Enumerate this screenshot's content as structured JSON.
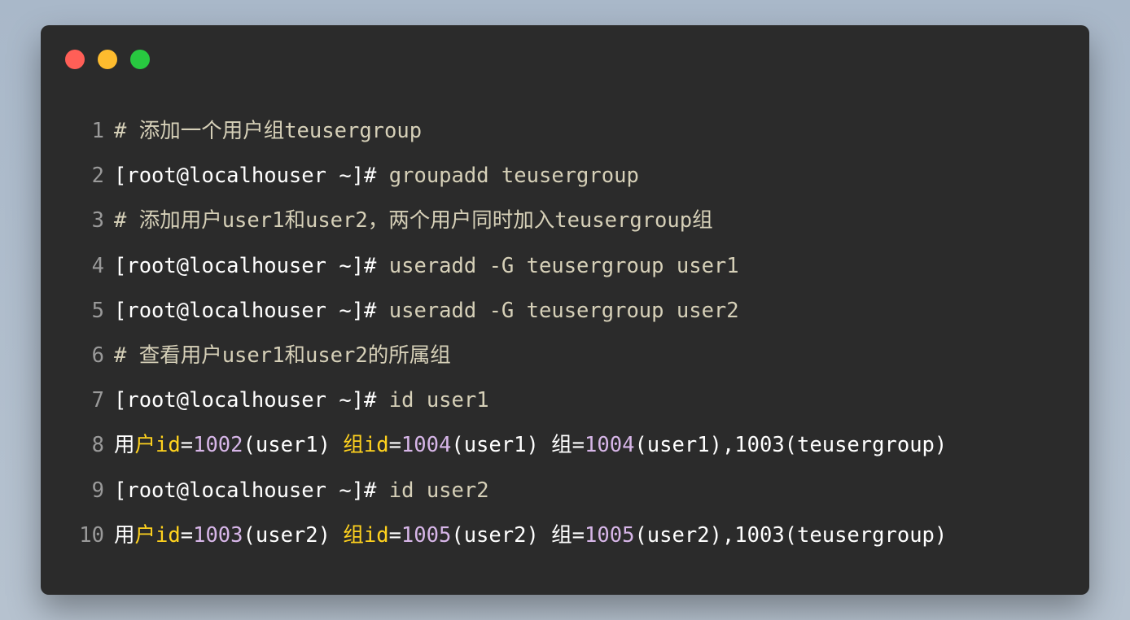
{
  "window": {
    "controls": {
      "close_color": "#ff5f57",
      "minimize_color": "#febc2e",
      "maximize_color": "#28c840"
    }
  },
  "code": {
    "lines": [
      {
        "number": "1",
        "tokens": [
          {
            "type": "comment",
            "text": "# 添加一个用户组teusergroup"
          }
        ]
      },
      {
        "number": "2",
        "tokens": [
          {
            "type": "prompt",
            "text": "[root@localhouser ~]#"
          },
          {
            "type": "cmd",
            "text": " groupadd teusergroup"
          }
        ]
      },
      {
        "number": "3",
        "tokens": [
          {
            "type": "comment",
            "text": "# 添加用户user1和user2，两个用户同时加入teusergroup组"
          }
        ]
      },
      {
        "number": "4",
        "tokens": [
          {
            "type": "prompt",
            "text": "[root@localhouser ~]#"
          },
          {
            "type": "cmd",
            "text": " useradd -G teusergroup user1"
          }
        ]
      },
      {
        "number": "5",
        "tokens": [
          {
            "type": "prompt",
            "text": "[root@localhouser ~]#"
          },
          {
            "type": "cmd",
            "text": " useradd -G teusergroup user2"
          }
        ]
      },
      {
        "number": "6",
        "tokens": [
          {
            "type": "comment",
            "text": "# 查看用户user1和user2的所属组"
          }
        ]
      },
      {
        "number": "7",
        "tokens": [
          {
            "type": "prompt",
            "text": "[root@localhouser ~]#"
          },
          {
            "type": "cmd",
            "text": " id user1"
          }
        ]
      },
      {
        "number": "8",
        "tokens": [
          {
            "type": "plain",
            "text": "用"
          },
          {
            "type": "keyword",
            "text": "户id"
          },
          {
            "type": "plain",
            "text": "="
          },
          {
            "type": "number",
            "text": "1002"
          },
          {
            "type": "plain",
            "text": "(user1) "
          },
          {
            "type": "keyword",
            "text": "组id"
          },
          {
            "type": "plain",
            "text": "="
          },
          {
            "type": "number",
            "text": "1004"
          },
          {
            "type": "plain",
            "text": "(user1) 组="
          },
          {
            "type": "number",
            "text": "1004"
          },
          {
            "type": "plain",
            "text": "(user1),1003(teusergroup)"
          }
        ]
      },
      {
        "number": "9",
        "tokens": [
          {
            "type": "prompt",
            "text": "[root@localhouser ~]#"
          },
          {
            "type": "cmd",
            "text": " id user2"
          }
        ]
      },
      {
        "number": "10",
        "tokens": [
          {
            "type": "plain",
            "text": "用"
          },
          {
            "type": "keyword",
            "text": "户id"
          },
          {
            "type": "plain",
            "text": "="
          },
          {
            "type": "number",
            "text": "1003"
          },
          {
            "type": "plain",
            "text": "(user2) "
          },
          {
            "type": "keyword",
            "text": "组id"
          },
          {
            "type": "plain",
            "text": "="
          },
          {
            "type": "number",
            "text": "1005"
          },
          {
            "type": "plain",
            "text": "(user2) 组="
          },
          {
            "type": "number",
            "text": "1005"
          },
          {
            "type": "plain",
            "text": "(user2),1003(teusergroup)"
          }
        ]
      }
    ]
  }
}
